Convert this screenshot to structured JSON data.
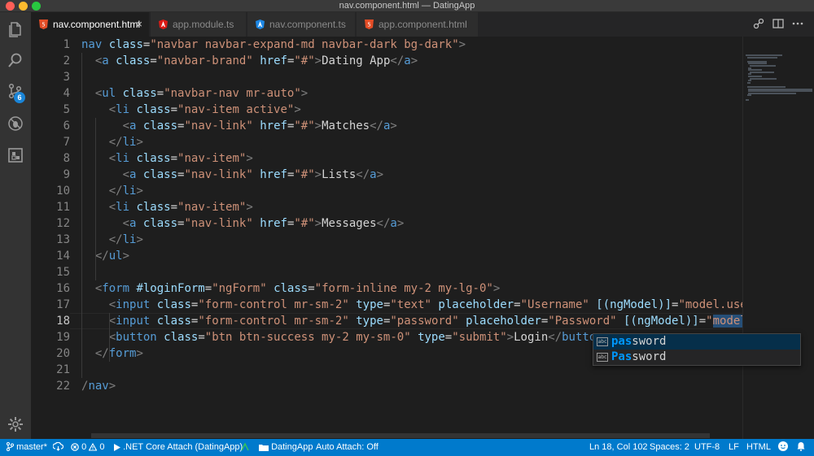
{
  "window": {
    "title": "nav.component.html — DatingApp"
  },
  "activity_bar": {
    "items": [
      {
        "name": "explorer",
        "icon": "files-icon"
      },
      {
        "name": "search",
        "icon": "search-icon"
      },
      {
        "name": "source-control",
        "icon": "source-control-icon",
        "badge": "6"
      },
      {
        "name": "debug",
        "icon": "debug-icon"
      },
      {
        "name": "extensions",
        "icon": "extensions-icon"
      }
    ],
    "settings_icon": "gear-icon"
  },
  "tabs": [
    {
      "label": "nav.component.html",
      "active": true,
      "icon": "html-icon",
      "color": "#e44d26"
    },
    {
      "label": "app.module.ts",
      "active": false,
      "icon": "angular-icon",
      "color": "#dd1b16"
    },
    {
      "label": "nav.component.ts",
      "active": false,
      "icon": "angular-icon",
      "color": "#1e88e5"
    },
    {
      "label": "app.component.html",
      "active": false,
      "icon": "html-icon",
      "color": "#e44d26"
    }
  ],
  "tab_close_glyph": "×",
  "editor": {
    "current_line": 18,
    "lines": [
      "nav class=\"navbar navbar-expand-md navbar-dark bg-dark\">",
      "  <a class=\"navbar-brand\" href=\"#\">Dating App</a>",
      "",
      "  <ul class=\"navbar-nav mr-auto\">",
      "    <li class=\"nav-item active\">",
      "      <a class=\"nav-link\" href=\"#\">Matches</a>",
      "    </li>",
      "    <li class=\"nav-item\">",
      "      <a class=\"nav-link\" href=\"#\">Lists</a>",
      "    </li>",
      "    <li class=\"nav-item\">",
      "      <a class=\"nav-link\" href=\"#\">Messages</a>",
      "    </li>",
      "  </ul>",
      "",
      "  <form #loginForm=\"ngForm\" class=\"form-inline my-2 my-lg-0\">",
      "    <input class=\"form-control mr-sm-2\" type=\"text\" placeholder=\"Username\" [(ngModel)]=\"model.username\"",
      "    <input class=\"form-control mr-sm-2\" type=\"password\" placeholder=\"Password\" [(ngModel)]=\"model.pas\"",
      "    <button class=\"btn btn-success my-2 my-sm-0\" type=\"submit\">Login</button>",
      "  </form>",
      "",
      "/nav>"
    ]
  },
  "suggestions": {
    "typed_prefix": "pas",
    "items": [
      {
        "label": "password",
        "kind": "abc",
        "selected": true
      },
      {
        "label": "Password",
        "kind": "abc",
        "selected": false
      }
    ]
  },
  "status_bar": {
    "branch": "master*",
    "errors": "0",
    "warnings": "0",
    "debug_config": ".NET Core Attach (DatingApp)",
    "folder": "DatingApp",
    "auto_attach": "Auto Attach: Off",
    "position": "Ln 18, Col 102",
    "spaces": "Spaces: 2",
    "encoding": "UTF-8",
    "eol": "LF",
    "language": "HTML"
  },
  "colors": {
    "status_bar": "#007acc",
    "tag": "#569cd6",
    "attribute": "#9cdcfe",
    "string": "#ce9178",
    "text": "#d4d4d4"
  }
}
